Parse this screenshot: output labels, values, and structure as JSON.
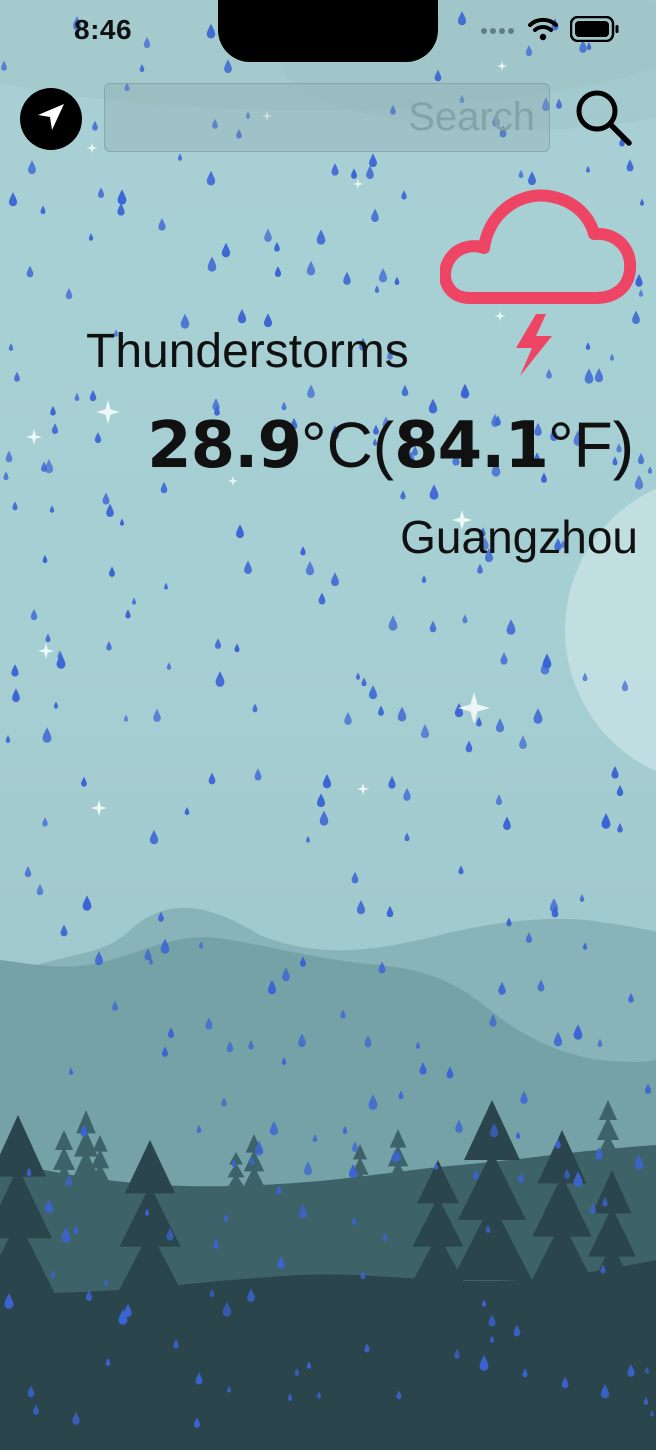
{
  "status_bar": {
    "time": "8:46",
    "icons": [
      "signal-dots-icon",
      "wifi-icon",
      "battery-icon"
    ]
  },
  "header": {
    "location_button_icon": "location-arrow-icon",
    "search_placeholder": "Search",
    "search_value": "",
    "search_button_icon": "magnifier-icon"
  },
  "weather": {
    "condition": "Thunderstorms",
    "icon": "cloud-lightning-icon",
    "icon_color": "#ef4565",
    "temp_c_value": "28.9",
    "temp_c_unit": "°C(",
    "temp_f_value": "84.1",
    "temp_f_unit": "°F)",
    "city": "Guangzhou"
  },
  "theme": {
    "sky_color": "#a8d0d4",
    "raindrop_color": "#3b64d4",
    "mountain_colors": [
      "#88b3b8",
      "#74a2a7",
      "#3d6368",
      "#2a454b"
    ]
  }
}
